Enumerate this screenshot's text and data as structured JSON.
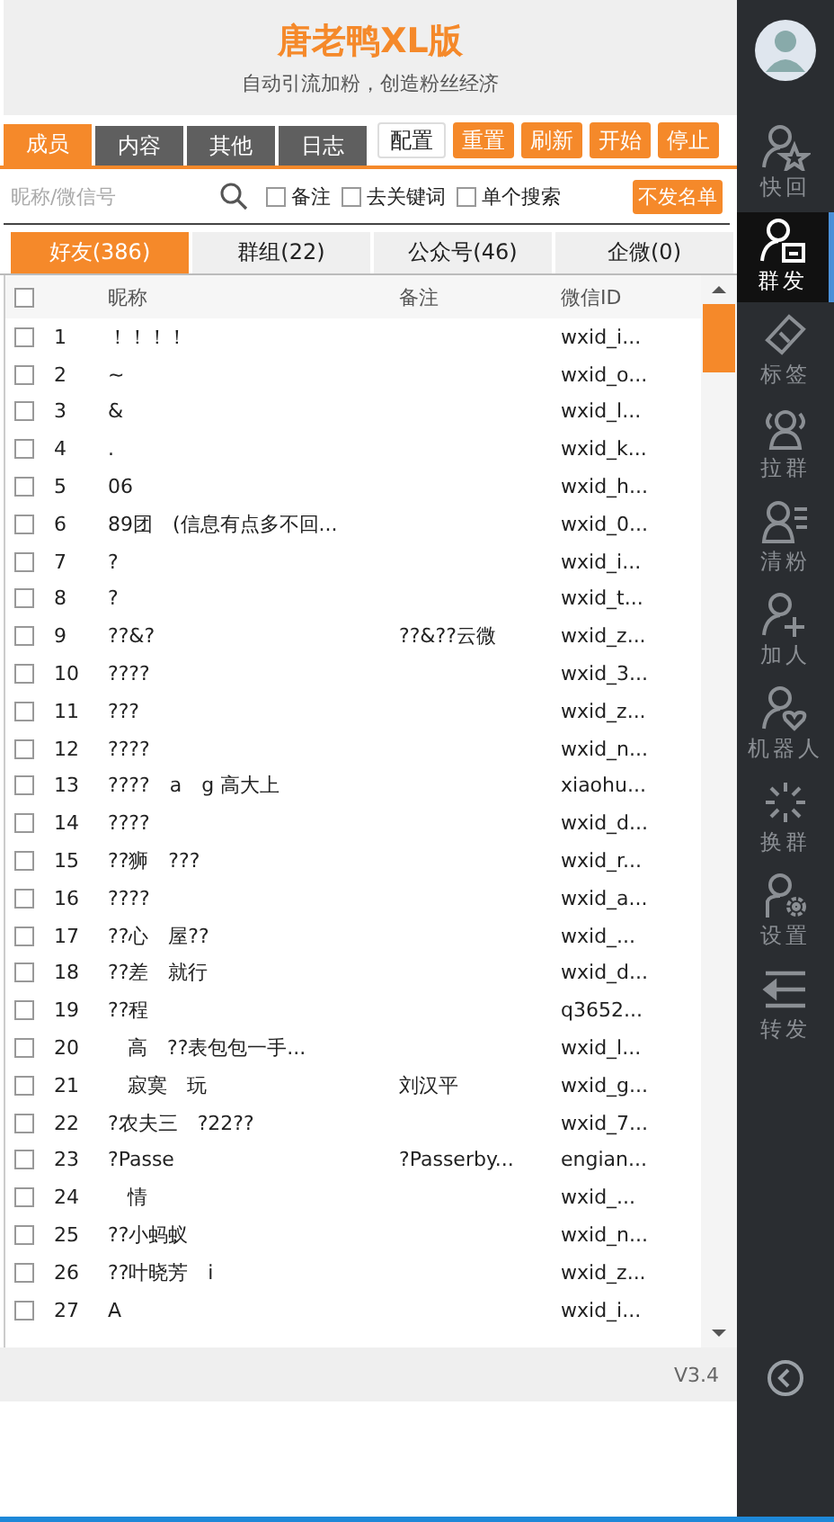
{
  "header": {
    "title": "唐老鸭XL版",
    "subtitle": "自动引流加粉，创造粉丝经济"
  },
  "tabs": [
    {
      "label": "成员",
      "selected": true
    },
    {
      "label": "内容",
      "selected": false
    },
    {
      "label": "其他",
      "selected": false
    },
    {
      "label": "日志",
      "selected": false
    }
  ],
  "toolbar": [
    {
      "label": "配置",
      "kind": "plain"
    },
    {
      "label": "重置",
      "kind": "action"
    },
    {
      "label": "刷新",
      "kind": "action"
    },
    {
      "label": "开始",
      "kind": "action"
    },
    {
      "label": "停止",
      "kind": "action"
    }
  ],
  "search": {
    "placeholder": "昵称/微信号"
  },
  "options": [
    {
      "label": "备注",
      "checked": false
    },
    {
      "label": "去关键词",
      "checked": false
    },
    {
      "label": "单个搜索",
      "checked": false
    }
  ],
  "exclude_button": "不发名单",
  "categories": [
    {
      "label": "好友(386)",
      "selected": true
    },
    {
      "label": "群组(22)",
      "selected": false
    },
    {
      "label": "公众号(46)",
      "selected": false
    },
    {
      "label": "企微(0)",
      "selected": false
    }
  ],
  "table": {
    "columns": [
      "昵称",
      "备注",
      "微信ID"
    ],
    "all_checked": false,
    "rows": [
      {
        "index": "1",
        "nickname": "！！！！",
        "note": "",
        "wxid": "wxid_i...",
        "checked": false
      },
      {
        "index": "2",
        "nickname": "~",
        "note": "",
        "wxid": "wxid_o...",
        "checked": false
      },
      {
        "index": "3",
        "nickname": "&",
        "note": "",
        "wxid": "wxid_l...",
        "checked": false
      },
      {
        "index": "4",
        "nickname": ".",
        "note": "",
        "wxid": "wxid_k...",
        "checked": false
      },
      {
        "index": "5",
        "nickname": "06",
        "note": "",
        "wxid": "wxid_h...",
        "checked": false
      },
      {
        "index": "6",
        "nickname": "89团　(信息有点多不回...",
        "note": "",
        "wxid": "wxid_0...",
        "checked": false
      },
      {
        "index": "7",
        "nickname": "?",
        "note": "",
        "wxid": "wxid_i...",
        "checked": false
      },
      {
        "index": "8",
        "nickname": "?",
        "note": "",
        "wxid": "wxid_t...",
        "checked": false
      },
      {
        "index": "9",
        "nickname": "??&?",
        "note": "??&??云微",
        "wxid": "wxid_z...",
        "checked": false
      },
      {
        "index": "10",
        "nickname": "????",
        "note": "",
        "wxid": "wxid_3...",
        "checked": false
      },
      {
        "index": "11",
        "nickname": "???",
        "note": "",
        "wxid": "wxid_z...",
        "checked": false
      },
      {
        "index": "12",
        "nickname": "????",
        "note": "",
        "wxid": "wxid_n...",
        "checked": false
      },
      {
        "index": "13",
        "nickname": "????　a　g 高大上",
        "note": "",
        "wxid": "xiaohu...",
        "checked": false
      },
      {
        "index": "14",
        "nickname": "????",
        "note": "",
        "wxid": "wxid_d...",
        "checked": false
      },
      {
        "index": "15",
        "nickname": "??狮　???",
        "note": "",
        "wxid": "wxid_r...",
        "checked": false
      },
      {
        "index": "16",
        "nickname": "????",
        "note": "",
        "wxid": "wxid_a...",
        "checked": false
      },
      {
        "index": "17",
        "nickname": "??心　屋??",
        "note": "",
        "wxid": "wxid_...",
        "checked": false
      },
      {
        "index": "18",
        "nickname": "??差　就行",
        "note": "",
        "wxid": "wxid_d...",
        "checked": false
      },
      {
        "index": "19",
        "nickname": "??程",
        "note": "",
        "wxid": "q3652...",
        "checked": false
      },
      {
        "index": "20",
        "nickname": "　高　??表包包一手...",
        "note": "",
        "wxid": "wxid_l...",
        "checked": false
      },
      {
        "index": "21",
        "nickname": "　寂寞　玩",
        "note": "刘汉平",
        "wxid": "wxid_g...",
        "checked": false
      },
      {
        "index": "22",
        "nickname": "?农夫三　?22??",
        "note": "",
        "wxid": "wxid_7...",
        "checked": false
      },
      {
        "index": "23",
        "nickname": "?Passe",
        "note": "?Passerby...",
        "wxid": "engian...",
        "checked": false
      },
      {
        "index": "24",
        "nickname": "　情",
        "note": "",
        "wxid": "wxid_...",
        "checked": false
      },
      {
        "index": "25",
        "nickname": "??小蚂蚁",
        "note": "",
        "wxid": "wxid_n...",
        "checked": false
      },
      {
        "index": "26",
        "nickname": "??叶晓芳　i",
        "note": "",
        "wxid": "wxid_z...",
        "checked": false
      },
      {
        "index": "27",
        "nickname": "A",
        "note": "",
        "wxid": "wxid_i...",
        "checked": false
      }
    ]
  },
  "version": "V3.4",
  "sidebar": {
    "items": [
      {
        "label": "快回",
        "kind": "star-user",
        "selected": false
      },
      {
        "label": "群发",
        "kind": "user-card",
        "selected": true
      },
      {
        "label": "标签",
        "kind": "tag",
        "selected": false
      },
      {
        "label": "拉群",
        "kind": "users",
        "selected": false
      },
      {
        "label": "清粉",
        "kind": "user-list",
        "selected": false
      },
      {
        "label": "加人",
        "kind": "user-plus",
        "selected": false
      },
      {
        "label": "机器人",
        "kind": "user-heart",
        "selected": false
      },
      {
        "label": "换群",
        "kind": "burst",
        "selected": false
      },
      {
        "label": "设置",
        "kind": "user-gear",
        "selected": false
      },
      {
        "label": "转发",
        "kind": "forward",
        "selected": false
      }
    ]
  }
}
